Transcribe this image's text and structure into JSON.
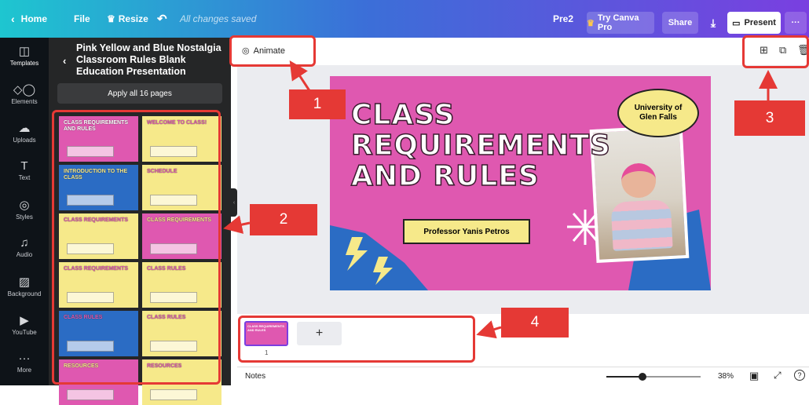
{
  "topbar": {
    "home": "Home",
    "file": "File",
    "resize": "Resize",
    "saved": "All changes saved",
    "doc_name": "Pre2",
    "try_pro": "Try Canva Pro",
    "share": "Share",
    "present": "Present",
    "more": "···"
  },
  "rail": [
    {
      "icon": "templates-icon",
      "glyph": "◫",
      "label": "Templates"
    },
    {
      "icon": "elements-icon",
      "glyph": "◇◯",
      "label": "Elements"
    },
    {
      "icon": "uploads-icon",
      "glyph": "☁",
      "label": "Uploads"
    },
    {
      "icon": "text-icon",
      "glyph": "T",
      "label": "Text"
    },
    {
      "icon": "styles-icon",
      "glyph": "◎",
      "label": "Styles"
    },
    {
      "icon": "audio-icon",
      "glyph": "♫",
      "label": "Audio"
    },
    {
      "icon": "background-icon",
      "glyph": "▨",
      "label": "Background"
    },
    {
      "icon": "youtube-icon",
      "glyph": "▶",
      "label": "YouTube"
    },
    {
      "icon": "more-icon",
      "glyph": "···",
      "label": "More"
    }
  ],
  "panel": {
    "title": "Pink Yellow and Blue Nostalgia Classroom Rules Blank Education Presentation",
    "apply_all": "Apply all 16 pages"
  },
  "thumbs": [
    {
      "text": "CLASS REQUIREMENTS AND RULES",
      "bg": "#df58b0",
      "fg": "#ffffff"
    },
    {
      "text": "WELCOME TO CLASS!",
      "bg": "#f6e98a",
      "fg": "#df58b0"
    },
    {
      "text": "INTRODUCTION TO THE CLASS",
      "bg": "#2b6cc4",
      "fg": "#f6e98a"
    },
    {
      "text": "SCHEDULE",
      "bg": "#f6e98a",
      "fg": "#df58b0"
    },
    {
      "text": "CLASS REQUIREMENTS",
      "bg": "#f6e98a",
      "fg": "#df58b0"
    },
    {
      "text": "CLASS REQUIREMENTS",
      "bg": "#df58b0",
      "fg": "#f6e98a"
    },
    {
      "text": "CLASS REQUIREMENTS",
      "bg": "#f6e98a",
      "fg": "#df58b0"
    },
    {
      "text": "CLASS RULES",
      "bg": "#f6e98a",
      "fg": "#df58b0"
    },
    {
      "text": "CLASS RULES",
      "bg": "#2b6cc4",
      "fg": "#df58b0"
    },
    {
      "text": "CLASS RULES",
      "bg": "#f6e98a",
      "fg": "#df58b0"
    },
    {
      "text": "RESOURCES",
      "bg": "#df58b0",
      "fg": "#f6e98a"
    },
    {
      "text": "RESOURCES",
      "bg": "#f6e98a",
      "fg": "#df58b0"
    }
  ],
  "canvas": {
    "animate": "Animate"
  },
  "slide": {
    "title": "CLASS REQUIREMENTS AND RULES",
    "line1": "CLASS",
    "line2": "REQUIREMENTS",
    "line3": "AND RULES",
    "badge": "University of Glen Falls",
    "presenter": "Professor Yanis Petros"
  },
  "callouts": {
    "c1": "1",
    "c2": "2",
    "c3": "3",
    "c4": "4"
  },
  "filmstrip": {
    "page_num": "1",
    "add": "+"
  },
  "bottom": {
    "notes": "Notes",
    "zoom": "38%",
    "zoom_level": 0.38
  },
  "colors": {
    "accent": "#7a3fe0",
    "pink": "#df58b0",
    "yellow": "#f6e98a",
    "blue": "#2b6cc4",
    "red": "#e53935"
  }
}
